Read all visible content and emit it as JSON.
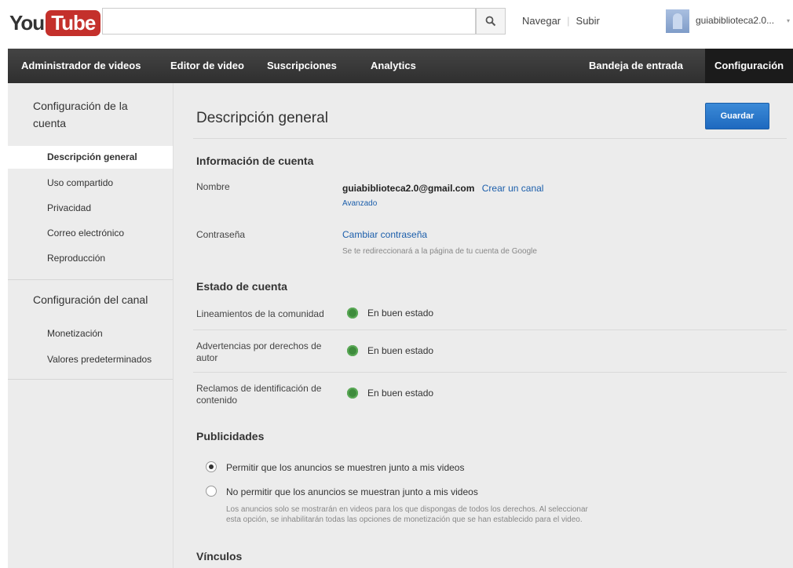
{
  "header": {
    "logo_you": "You",
    "logo_tube": "Tube",
    "search_placeholder": "",
    "nav_browse": "Navegar",
    "nav_sep": "|",
    "nav_upload": "Subir",
    "user_name": "guiabiblioteca2.0...",
    "user_caret": "▾"
  },
  "navbar": {
    "video_manager": "Administrador de videos",
    "video_editor": "Editor de video",
    "subscriptions": "Suscripciones",
    "analytics": "Analytics",
    "inbox": "Bandeja de entrada",
    "settings": "Configuración"
  },
  "sidebar": {
    "account_heading_line1": "Configuración de la",
    "account_heading_line2": "cuenta",
    "account_items": [
      "Descripción general",
      "Uso compartido",
      "Privacidad",
      "Correo electrónico",
      "Reproducción"
    ],
    "channel_heading": "Configuración del canal",
    "channel_items": [
      "Monetización",
      "Valores predeterminados"
    ]
  },
  "main": {
    "title": "Descripción general",
    "save_label": "Guardar",
    "account_info": {
      "heading": "Información de cuenta",
      "name_label": "Nombre",
      "email": "guiabiblioteca2.0@gmail.com",
      "create_channel": "Crear un canal",
      "advanced": "Avanzado",
      "password_label": "Contraseña",
      "change_password": "Cambiar contraseña",
      "redirect_note": "Se te redireccionará a la página de tu cuenta de Google"
    },
    "account_status": {
      "heading": "Estado de cuenta",
      "rows": [
        {
          "label_line1": "Lineamientos de la comunidad",
          "label_line2": "",
          "status": "En buen estado"
        },
        {
          "label_line1": "Advertencias por derechos de",
          "label_line2": "autor",
          "status": "En buen estado"
        },
        {
          "label_line1": "Reclamos de identificación de",
          "label_line2": "contenido",
          "status": "En buen estado"
        }
      ],
      "status_color": "#3e8b3c"
    },
    "ads": {
      "heading": "Publicidades",
      "option_allow": "Permitir que los anuncios se muestren junto a mis videos",
      "option_disallow": "No permitir que los anuncios se muestran junto a mis videos",
      "note_line1": "Los anuncios solo se mostrarán en videos para los que dispongas de todos los derechos. Al seleccionar",
      "note_line2": "esta opción, se inhabilitarán todas las opciones de monetización que se han establecido para el video.",
      "selected": "allow"
    },
    "links": {
      "heading": "Vínculos"
    }
  },
  "colors": {
    "brand_red": "#c4302b",
    "link_blue": "#1b5eab",
    "save_blue": "#1e69bf"
  }
}
